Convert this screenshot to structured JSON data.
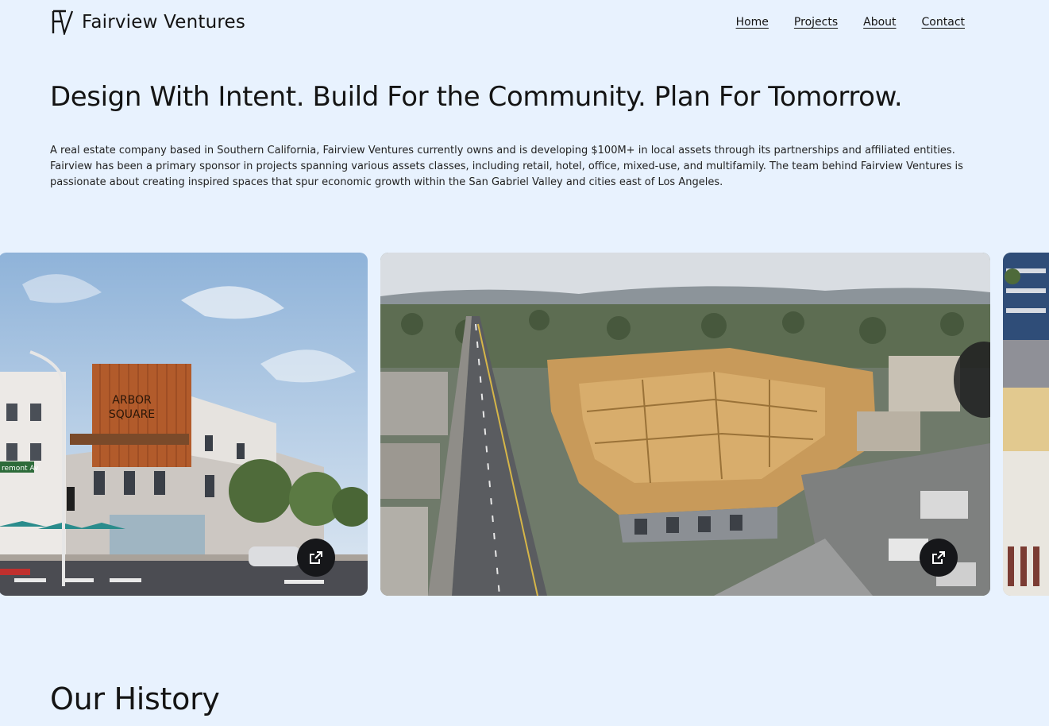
{
  "header": {
    "brand_name": "Fairview Ventures",
    "logo_icon": "fv-monogram-icon",
    "nav": [
      {
        "label": "Home"
      },
      {
        "label": "Projects"
      },
      {
        "label": "About"
      },
      {
        "label": "Contact"
      }
    ]
  },
  "hero": {
    "headline": "Design With Intent. Build For the Community. Plan For Tomorrow.",
    "intro": "A real estate company based in Southern California, Fairview Ventures currently owns and is developing $100M+ in local assets through its partnerships and affiliated entities. Fairview has been a primary sponsor in projects spanning various assets classes, including retail, hotel, office, mixed-use, and multifamily. The team behind Fairview Ventures is passionate about creating inspired spaces that spur economic growth within the San Gabriel Valley and cities east of Los Angeles."
  },
  "projects": {
    "slides": [
      {
        "sign_text": "ARBOR SQUARE",
        "street_sign": "remont Av",
        "icon": "external-link-icon"
      },
      {
        "icon": "external-link-icon"
      },
      {}
    ]
  },
  "history": {
    "title": "Our History"
  },
  "colors": {
    "background": "#e8f2fe",
    "text": "#141414",
    "button": "#16171a"
  }
}
